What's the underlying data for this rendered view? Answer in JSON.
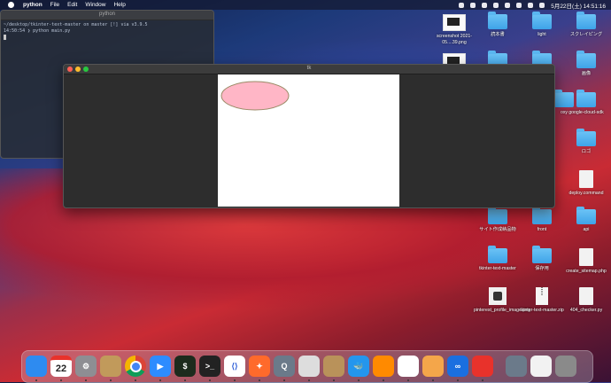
{
  "menubar": {
    "app": "python",
    "items": [
      "File",
      "Edit",
      "Window",
      "Help"
    ],
    "clock": "5月22日(土)  14:51:16"
  },
  "terminal": {
    "title": "python",
    "line1": "~/desktop/tkinter-text-master on  master [!] via  v3.9.5",
    "line2": "14:50:54 ❯ python main.py"
  },
  "tk_window": {
    "title": "tk"
  },
  "oval": {
    "fill": "#ffb6c6",
    "outline": "#9a8a66"
  },
  "desktop": {
    "icons": [
      {
        "label": "screenshot 2021-05....39.png",
        "kind": "shot"
      },
      {
        "label": "読本書",
        "kind": "folder"
      },
      {
        "label": "light",
        "kind": "folder"
      },
      {
        "label": "スクレイピング",
        "kind": "folder"
      },
      {
        "label": "",
        "kind": "shot"
      },
      {
        "label": "",
        "kind": "folder"
      },
      {
        "label": "",
        "kind": "folder"
      },
      {
        "label": "画像",
        "kind": "folder"
      },
      {
        "label": "oxy",
        "kind": "folder"
      },
      {
        "label": "google-cloud-sdk",
        "kind": "folder"
      },
      {
        "label": "ロゴ",
        "kind": "folder"
      },
      {
        "label": "deploy.command",
        "kind": "doc"
      },
      {
        "label": "サイト作成納品物",
        "kind": "folder"
      },
      {
        "label": "front",
        "kind": "folder"
      },
      {
        "label": "api",
        "kind": "folder"
      },
      {
        "label": "tkinter-text-master",
        "kind": "folder"
      },
      {
        "label": "保存用",
        "kind": "folder"
      },
      {
        "label": "create_sitemap.php",
        "kind": "doc"
      },
      {
        "label": "pinterest_profile_image.png",
        "kind": "pimg"
      },
      {
        "label": "tkinter-text-master.zip",
        "kind": "zip"
      },
      {
        "label": "404_checker.py",
        "kind": "doc"
      }
    ]
  },
  "dock": {
    "calendar_day": "22",
    "apps": [
      {
        "name": "finder-icon",
        "color": "#2e8bf0",
        "glyph": ""
      },
      {
        "name": "calendar-icon",
        "color": "#ffffff",
        "glyph": ""
      },
      {
        "name": "system-preferences-icon",
        "color": "#8e8e93",
        "glyph": "⚙"
      },
      {
        "name": "app-icon",
        "color": "#c19a5b",
        "glyph": ""
      },
      {
        "name": "chrome-icon",
        "color": "#ffffff",
        "glyph": ""
      },
      {
        "name": "zoom-icon",
        "color": "#2d8cff",
        "glyph": "▶"
      },
      {
        "name": "iterm-icon",
        "color": "#1d2b1d",
        "glyph": "$"
      },
      {
        "name": "terminal-icon",
        "color": "#222222",
        "glyph": ">_"
      },
      {
        "name": "vscode-icon",
        "color": "#ffffff",
        "glyph": "⟨⟩"
      },
      {
        "name": "safari-icon",
        "color": "#ff6a2b",
        "glyph": "✦"
      },
      {
        "name": "quicktime-icon",
        "color": "#6b7a8a",
        "glyph": "Q"
      },
      {
        "name": "sequel-icon",
        "color": "#dddddd",
        "glyph": ""
      },
      {
        "name": "archive-icon",
        "color": "#b9925a",
        "glyph": ""
      },
      {
        "name": "docker-icon",
        "color": "#2496ed",
        "glyph": "🐳"
      },
      {
        "name": "sourcetree-icon",
        "color": "#ff8a00",
        "glyph": ""
      },
      {
        "name": "github-desktop-icon",
        "color": "#ffffff",
        "glyph": ""
      },
      {
        "name": "preview-icon",
        "color": "#f4a64a",
        "glyph": ""
      },
      {
        "name": "infinity-icon",
        "color": "#1a6fe0",
        "glyph": "∞"
      },
      {
        "name": "clock-icon",
        "color": "#e8322b",
        "glyph": ""
      },
      {
        "name": "downloads-icon",
        "color": "#6b7a8a",
        "glyph": ""
      },
      {
        "name": "document-icon",
        "color": "#f2f2f2",
        "glyph": ""
      },
      {
        "name": "trash-icon",
        "color": "#8a8a8a",
        "glyph": ""
      }
    ]
  }
}
